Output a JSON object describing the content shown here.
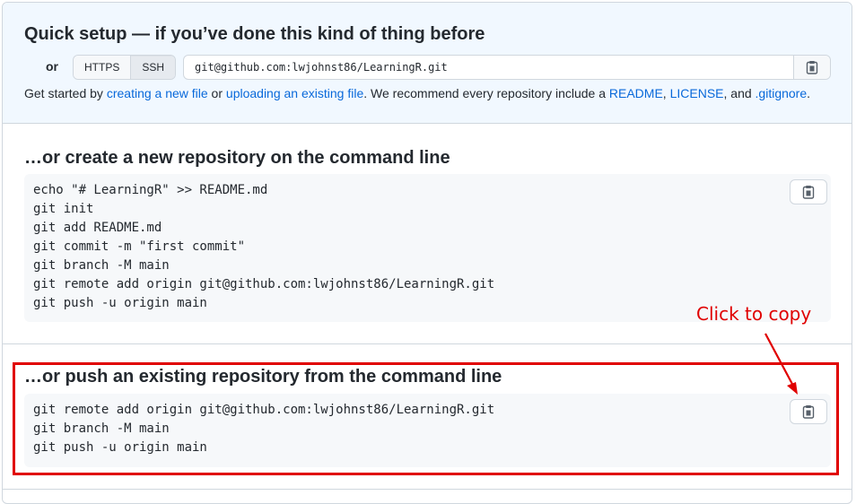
{
  "quick_setup": {
    "title": "Quick setup — if you’ve done this kind of thing before",
    "or_label": "or",
    "protocols": [
      "HTTPS",
      "SSH"
    ],
    "selected_protocol": "SSH",
    "clone_url": "git@github.com:lwjohnst86/LearningR.git",
    "get_started": {
      "prefix": "Get started by ",
      "link_new_file": "creating a new file",
      "or_text": " or ",
      "link_upload": "uploading an existing file",
      "middle": ". We recommend every repository include a ",
      "link_readme": "README",
      "comma": ", ",
      "link_license": "LICENSE",
      "and_text": ", and ",
      "link_gitignore": ".gitignore",
      "suffix": "."
    }
  },
  "new_repo": {
    "title": "…or create a new repository on the command line",
    "code": "echo \"# LearningR\" >> README.md\ngit init\ngit add README.md\ngit commit -m \"first commit\"\ngit branch -M main\ngit remote add origin git@github.com:lwjohnst86/LearningR.git\ngit push -u origin main"
  },
  "push_existing": {
    "title": "…or push an existing repository from the command line",
    "code": "git remote add origin git@github.com:lwjohnst86/LearningR.git\ngit branch -M main\ngit push -u origin main"
  },
  "annotation": {
    "text": "Click to copy",
    "color": "#e00000"
  },
  "icons": {
    "copy": "clipboard-icon"
  },
  "colors": {
    "link": "#0969da",
    "quick_bg": "#f1f8ff",
    "code_bg": "#f6f8fa",
    "border": "#d0d7de"
  }
}
